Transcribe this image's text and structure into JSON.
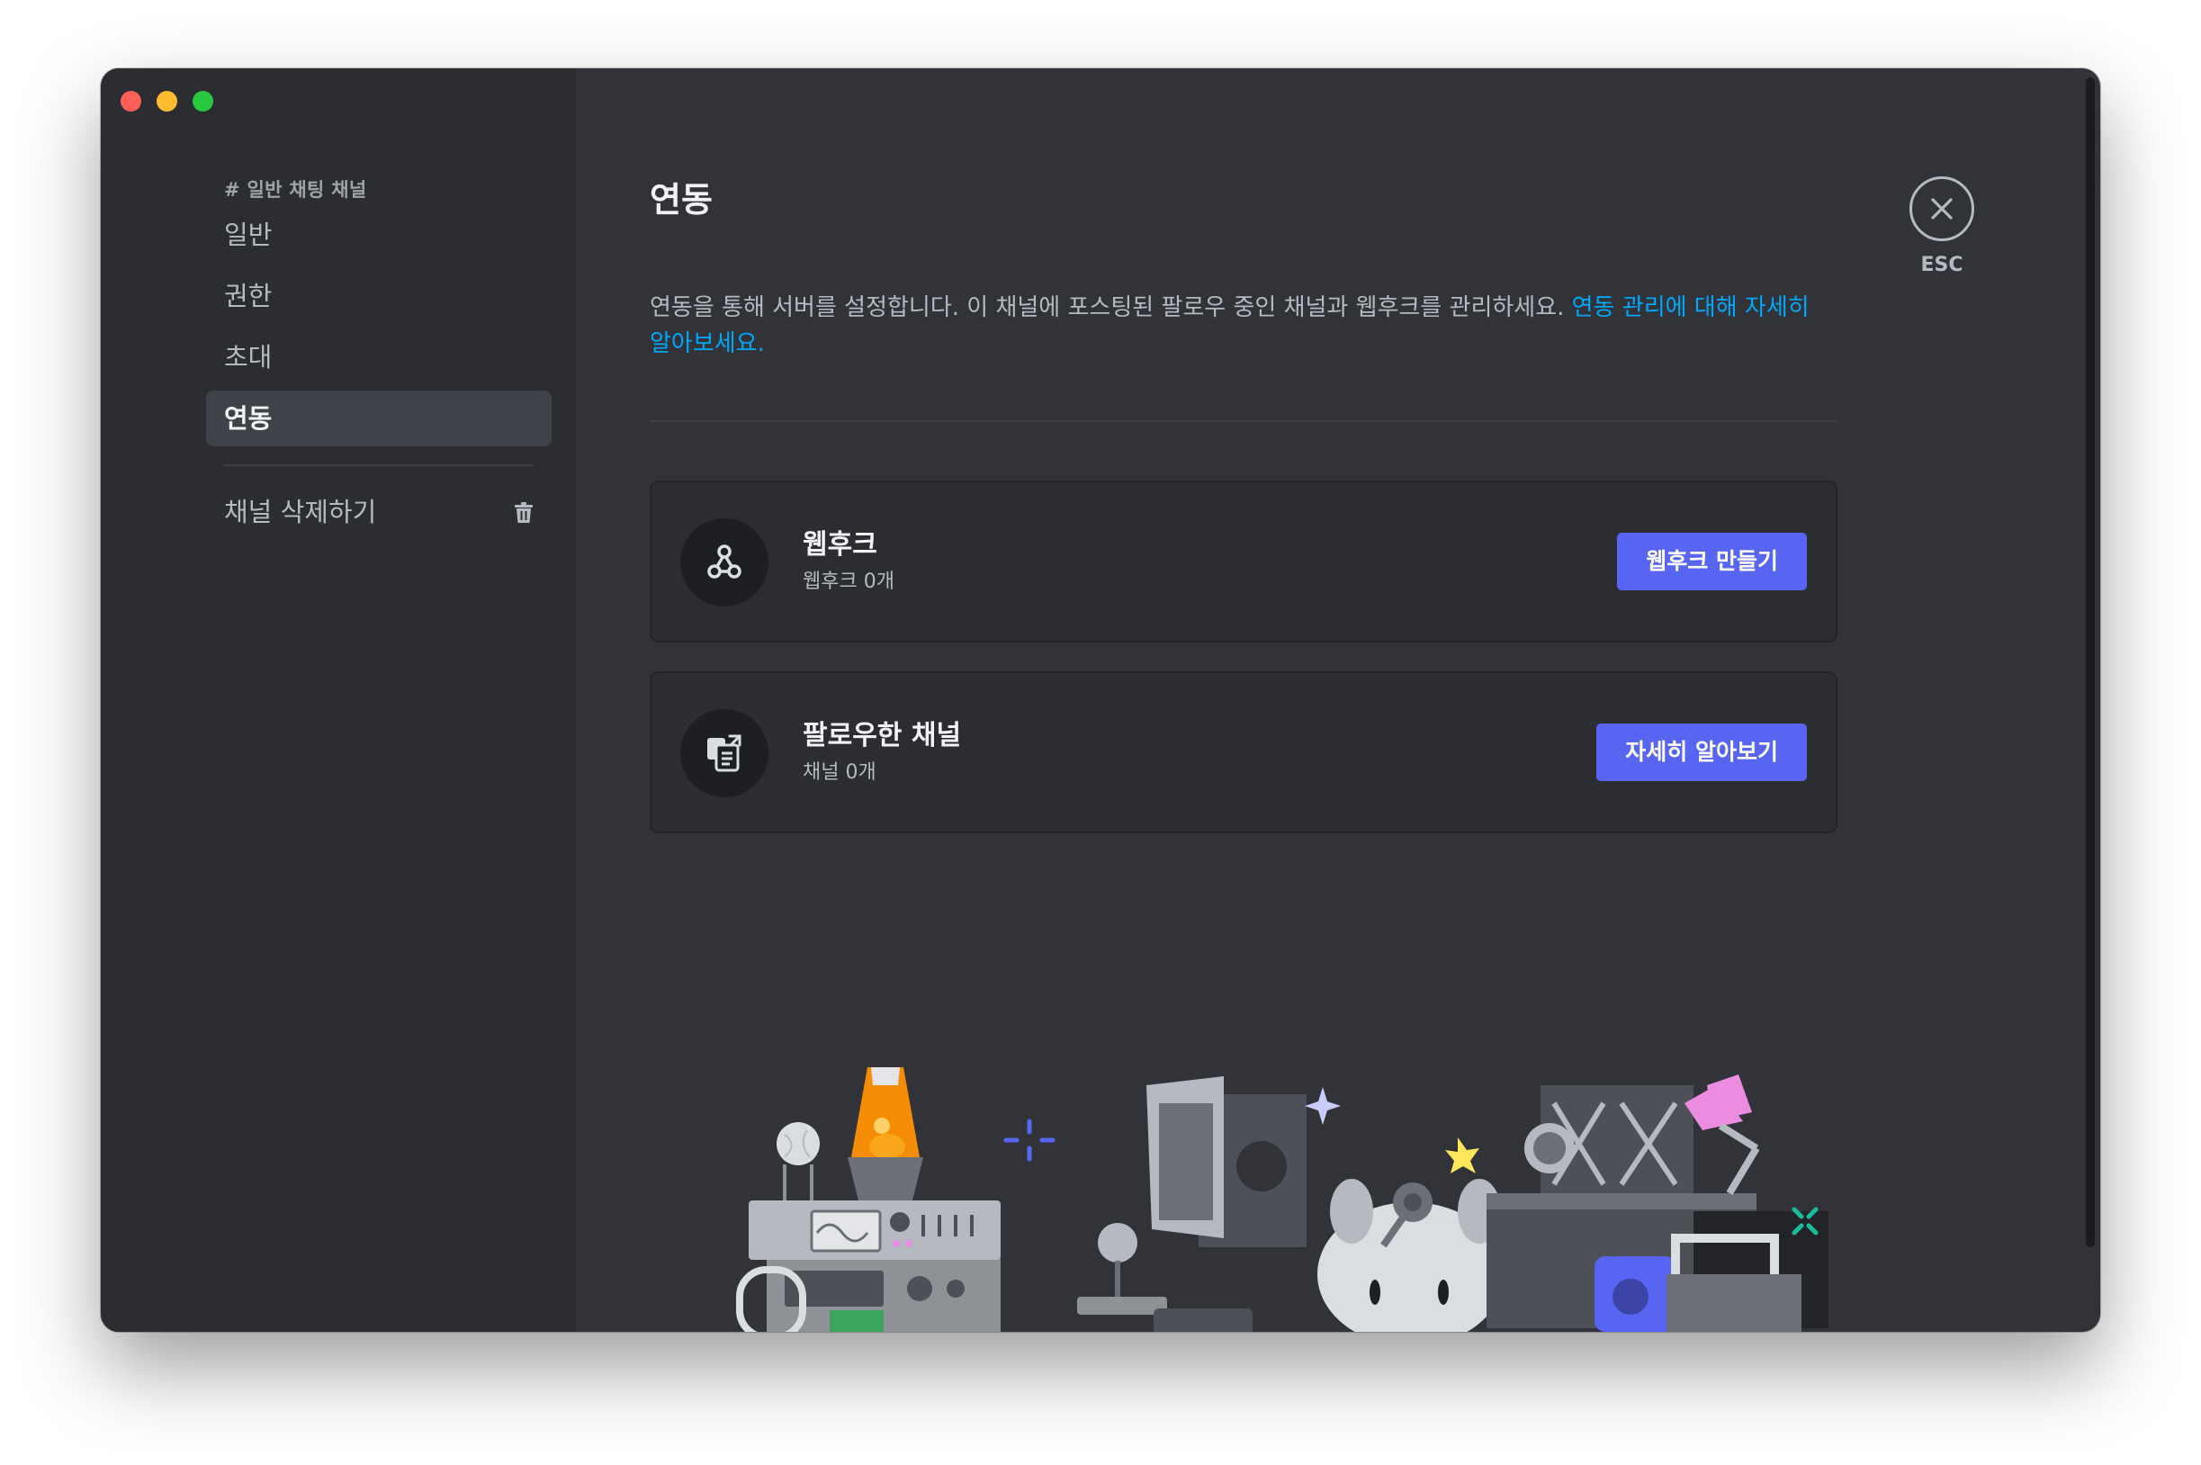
{
  "sidebar": {
    "header": "# 일반 채팅 채널",
    "items": [
      {
        "label": "일반",
        "active": false
      },
      {
        "label": "권한",
        "active": false
      },
      {
        "label": "초대",
        "active": false
      },
      {
        "label": "연동",
        "active": true
      }
    ],
    "delete_label": "채널 삭제하기"
  },
  "main": {
    "title": "연동",
    "description": "연동을 통해 서버를 설정합니다. 이 채널에 포스팅된 팔로우 중인 채널과 웹후크를 관리하세요. ",
    "description_link": "연동 관리에 대해 자세히 알아보세요.",
    "cards": [
      {
        "icon": "webhook-icon",
        "title": "웹후크",
        "subtitle": "웹후크 0개",
        "button": "웹후크 만들기"
      },
      {
        "icon": "followed-channel-icon",
        "title": "팔로우한 채널",
        "subtitle": "채널 0개",
        "button": "자세히 알아보기"
      }
    ]
  },
  "close": {
    "label": "ESC"
  },
  "colors": {
    "sidebar_bg": "#2b2d31",
    "content_bg": "#313338",
    "card_bg": "#2b2d31",
    "accent_button": "#5865f2",
    "link": "#00a8fc",
    "active_item_bg": "#404249"
  }
}
